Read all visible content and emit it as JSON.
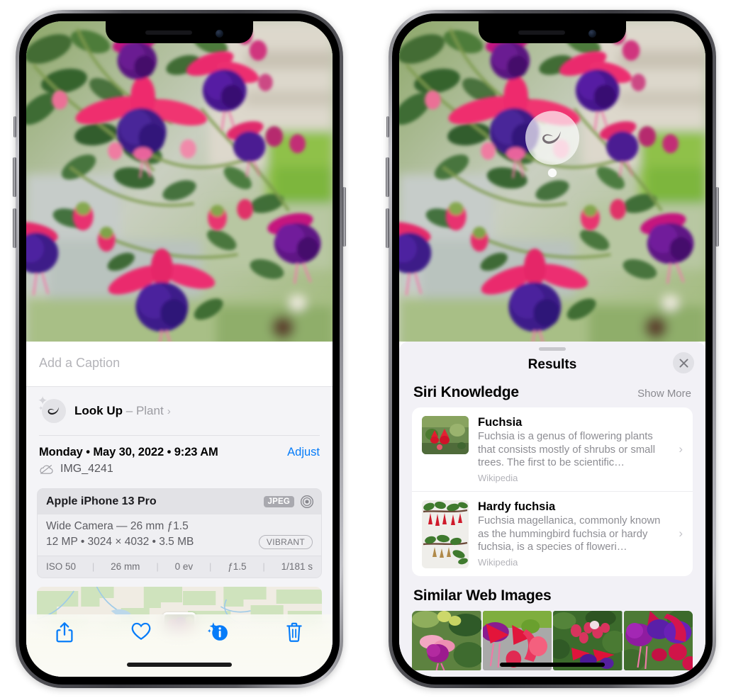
{
  "left_phone": {
    "photo": {
      "alt": "fuchsia-flowers-hanging-basket"
    },
    "caption": {
      "placeholder": "Add a Caption",
      "value": ""
    },
    "lookup": {
      "label": "Look Up",
      "dash": "–",
      "subject": "Plant",
      "chevron": "›",
      "icon": "leaf-icon"
    },
    "datetime": {
      "text": "Monday • May 30, 2022 • 9:23 AM",
      "adjust_label": "Adjust"
    },
    "filename": {
      "text": "IMG_4241",
      "icon": "icloud-slash-icon"
    },
    "exif": {
      "model": "Apple iPhone 13 Pro",
      "format_chip": "JPEG",
      "aperture_icon": "lens-icon",
      "lens": "Wide Camera — 26 mm ƒ1.5",
      "size_line": "12 MP • 3024 × 4032 • 3.5 MB",
      "style_chip": "VIBRANT",
      "stats": [
        "ISO 50",
        "26 mm",
        "0 ev",
        "ƒ1.5",
        "1/181 s"
      ]
    },
    "toolbar": [
      {
        "name": "share-button",
        "icon": "share-icon"
      },
      {
        "name": "favorite-button",
        "icon": "heart-icon"
      },
      {
        "name": "info-button",
        "icon": "info-sparkle-icon"
      },
      {
        "name": "delete-button",
        "icon": "trash-icon"
      }
    ],
    "accent_color": "#067cf9"
  },
  "right_phone": {
    "photo_badge": {
      "icon": "leaf-icon",
      "name": "visual-lookup-badge"
    },
    "sheet": {
      "title": "Results",
      "close_icon": "close-icon",
      "sections": [
        {
          "title": "Siri Knowledge",
          "action": "Show More",
          "cards": [
            {
              "title": "Fuchsia",
              "description": "Fuchsia is a genus of flowering plants that consists mostly of shrubs or small trees. The first to be scientific…",
              "source": "Wikipedia",
              "chevron": "›"
            },
            {
              "title": "Hardy fuchsia",
              "description": "Fuchsia magellanica, commonly known as the hummingbird fuchsia or hardy fuchsia, is a species of floweri…",
              "source": "Wikipedia",
              "chevron": "›"
            }
          ]
        },
        {
          "title": "Similar Web Images",
          "thumbnails": [
            {
              "name": "web-image-1"
            },
            {
              "name": "web-image-2"
            },
            {
              "name": "web-image-3"
            },
            {
              "name": "web-image-4"
            }
          ]
        }
      ]
    }
  },
  "colors": {
    "accent": "#067cf9",
    "sheet_bg": "#f2f1f6",
    "card_bg": "#ffffff",
    "secondary_text": "#8d8d93"
  }
}
